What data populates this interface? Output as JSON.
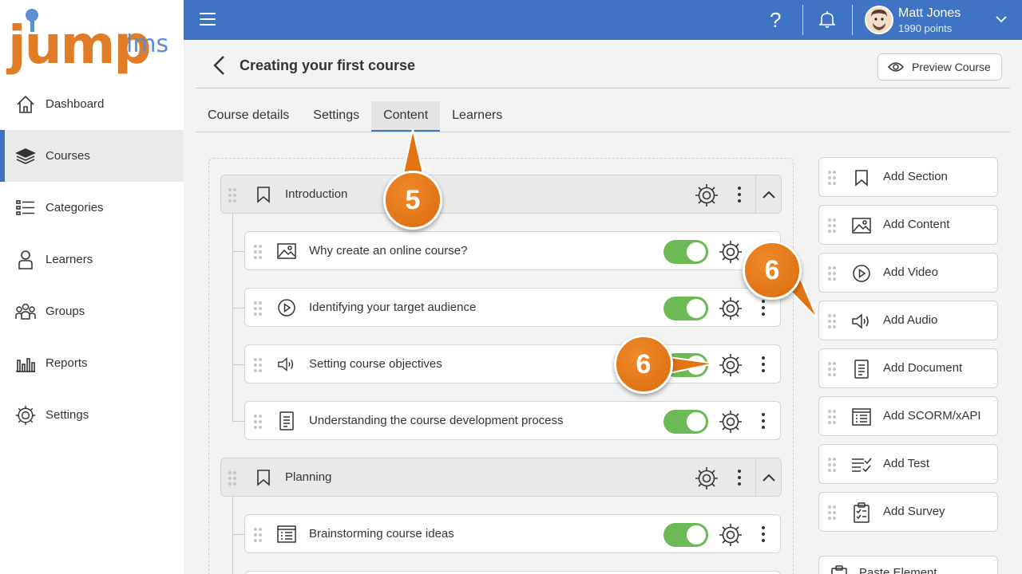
{
  "brand": {
    "logo_main": "jump",
    "logo_sub": "lms"
  },
  "sidebar": {
    "items": [
      {
        "label": "Dashboard",
        "icon": "home-icon",
        "active": false
      },
      {
        "label": "Courses",
        "icon": "books-icon",
        "active": true
      },
      {
        "label": "Categories",
        "icon": "list-icon",
        "active": false
      },
      {
        "label": "Learners",
        "icon": "person-icon",
        "active": false
      },
      {
        "label": "Groups",
        "icon": "group-icon",
        "active": false
      },
      {
        "label": "Reports",
        "icon": "bar-chart-icon",
        "active": false
      },
      {
        "label": "Settings",
        "icon": "gear-icon",
        "active": false
      }
    ]
  },
  "header": {
    "help": "?",
    "user": {
      "name": "Matt Jones",
      "points": "1990 points"
    }
  },
  "page": {
    "title": "Creating your first course",
    "preview_label": "Preview Course"
  },
  "tabs": [
    {
      "label": "Course details",
      "active": false
    },
    {
      "label": "Settings",
      "active": false
    },
    {
      "label": "Content",
      "active": true
    },
    {
      "label": "Learners",
      "active": false
    }
  ],
  "content": {
    "sections": [
      {
        "title": "Introduction",
        "items": [
          {
            "label": "Why create an online course?",
            "type": "image-icon",
            "enabled": true
          },
          {
            "label": "Identifying your target audience",
            "type": "play-icon",
            "enabled": true
          },
          {
            "label": "Setting course objectives",
            "type": "speaker-icon",
            "enabled": true
          },
          {
            "label": "Understanding the course development process",
            "type": "document-icon",
            "enabled": true
          }
        ]
      },
      {
        "title": "Planning",
        "items": [
          {
            "label": "Brainstorming course ideas",
            "type": "scorm-icon",
            "enabled": true
          }
        ]
      }
    ]
  },
  "add_panel": [
    {
      "label": "Add Section",
      "icon": "bookmark-icon"
    },
    {
      "label": "Add Content",
      "icon": "image-icon"
    },
    {
      "label": "Add Video",
      "icon": "play-icon"
    },
    {
      "label": "Add Audio",
      "icon": "speaker-icon"
    },
    {
      "label": "Add Document",
      "icon": "document-icon"
    },
    {
      "label": "Add SCORM/xAPI",
      "icon": "scorm-icon"
    },
    {
      "label": "Add Test",
      "icon": "checklist-icon"
    },
    {
      "label": "Add Survey",
      "icon": "clipboard-icon"
    },
    {
      "label": "Paste Element",
      "icon": "paste-icon"
    }
  ],
  "callouts": [
    "5",
    "6",
    "6"
  ],
  "colors": {
    "header": "#3f74c4",
    "accent": "#3e73c3",
    "toggle_on": "#6cba55",
    "callout": "#e27412"
  }
}
